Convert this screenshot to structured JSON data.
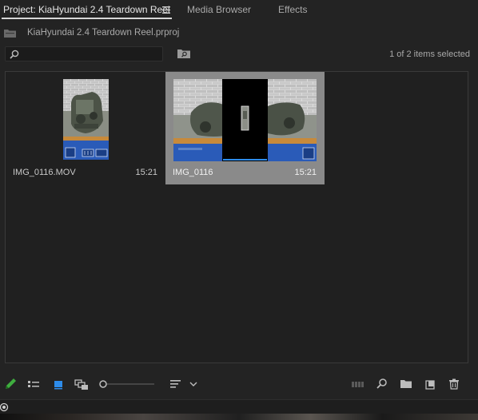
{
  "tabs": [
    {
      "label": "Project: KiaHyundai 2.4 Teardown Reel",
      "active": true
    },
    {
      "label": "Media Browser",
      "active": false
    },
    {
      "label": "Effects",
      "active": false
    }
  ],
  "project": {
    "filename": "KiaHyundai 2.4 Teardown Reel.prproj"
  },
  "search": {
    "value": "",
    "placeholder": ""
  },
  "selection_status": "1 of 2 items selected",
  "items": [
    {
      "name": "IMG_0116.MOV",
      "duration": "15:21",
      "selected": false,
      "orientation": "portrait"
    },
    {
      "name": "IMG_0116",
      "duration": "15:21",
      "selected": true,
      "orientation": "landscape"
    }
  ],
  "toolbar": {
    "left_icons": [
      "pencil-icon",
      "list-view-icon",
      "icon-view-icon",
      "freeform-view-icon",
      "zoom-slider",
      "sort-icon",
      "chevron-down-icon"
    ],
    "right_icons": [
      "automate-to-sequence-icon",
      "find-icon",
      "new-bin-icon",
      "new-item-icon",
      "trash-icon"
    ]
  },
  "colors": {
    "background": "#232323",
    "selected_item": "#8a8a8a",
    "accent_blue": "#2d8ceb",
    "pencil_green": "#3fae3f"
  }
}
